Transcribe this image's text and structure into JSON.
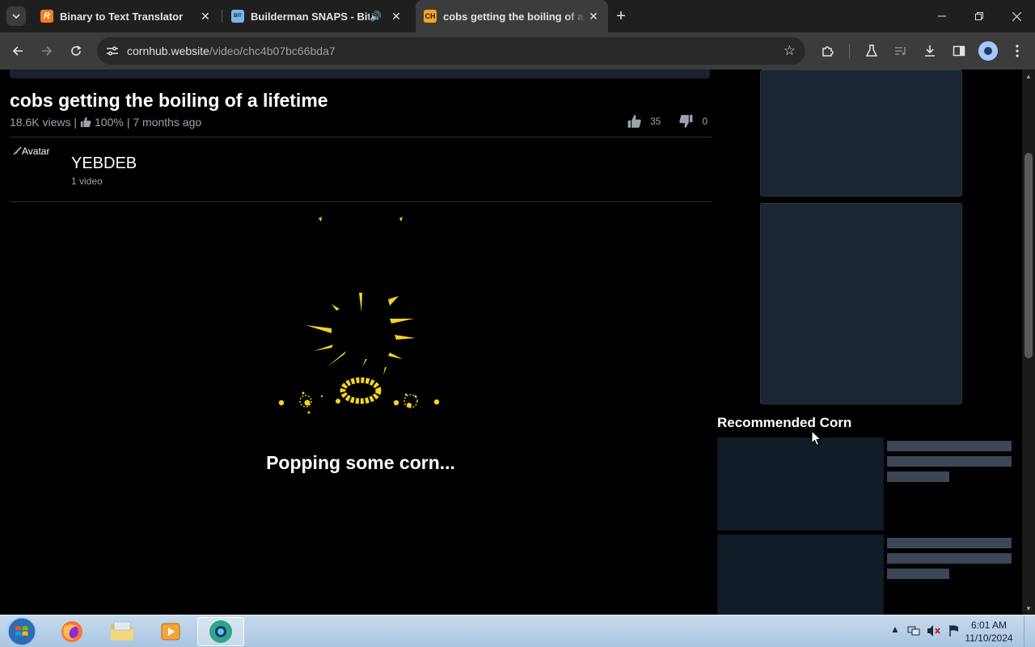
{
  "browser": {
    "tabs": [
      {
        "title": "Binary to Text Translator",
        "favicon_letter": "R",
        "favicon_color": "#f57c1f"
      },
      {
        "title": "Builderman SNAPS - BitView",
        "favicon_letter": "BIT",
        "favicon_color": "#7fb2e5"
      },
      {
        "title": "cobs getting the boiling of a lifetime",
        "favicon_letter": "CH",
        "favicon_color": "#f5a623",
        "active": true
      }
    ],
    "url_host": "cornhub.website",
    "url_path": "/video/chc4b07bc66bda7"
  },
  "video": {
    "title": "cobs getting the boiling of a lifetime",
    "views": "18.6K views |",
    "rating": "100%",
    "age": "| 7 months ago",
    "likes": "35",
    "dislikes": "0"
  },
  "channel": {
    "avatar_alt": "Avatar",
    "name": "YEBDEB",
    "videos": "1 video"
  },
  "player": {
    "loading_text": "Popping some corn..."
  },
  "sidebar": {
    "recommended_title": "Recommended Corn"
  },
  "taskbar": {
    "time": "6:01 AM",
    "date": "11/10/2024"
  },
  "colors": {
    "accent_corn": "#f5d421",
    "card_bg": "#1c2533",
    "skeleton": "#3b4656"
  }
}
